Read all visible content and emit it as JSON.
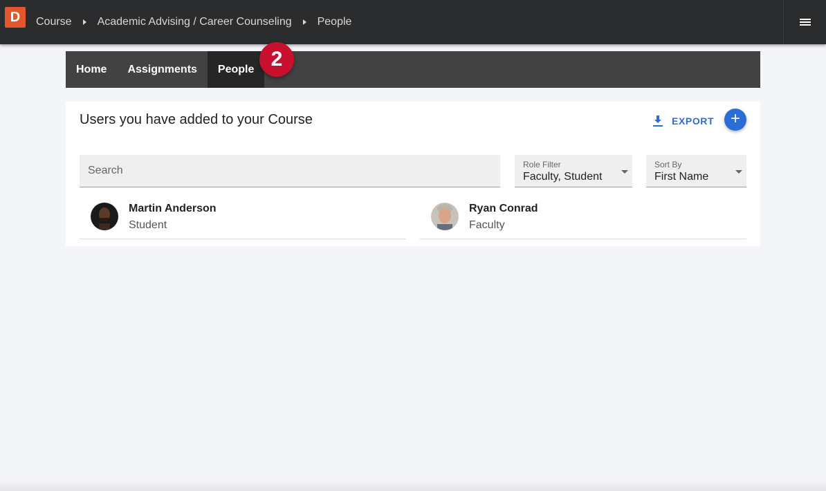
{
  "app": {
    "logo_letter": "D",
    "breadcrumbs": [
      "Course",
      "Academic Advising / Career Counseling",
      "People"
    ]
  },
  "tabs": [
    {
      "label": "Home",
      "active": false
    },
    {
      "label": "Assignments",
      "active": false
    },
    {
      "label": "People",
      "active": true
    }
  ],
  "step_badge": "2",
  "card": {
    "title": "Users you have added to your Course",
    "export_label": "EXPORT",
    "add_label": "+",
    "search": {
      "placeholder": "Search",
      "value": ""
    },
    "role_filter": {
      "label": "Role Filter",
      "value": "Faculty, Student"
    },
    "sort_by": {
      "label": "Sort By",
      "value": "First Name"
    },
    "people": [
      {
        "name": "Martin Anderson",
        "role": "Student"
      },
      {
        "name": "Ryan Conrad",
        "role": "Faculty"
      }
    ]
  },
  "colors": {
    "topbar": "#2b2c2e",
    "logo": "#e4572e",
    "tabbar": "#424242",
    "tab_active": "#262626",
    "badge": "#c8102e",
    "accent": "#2a6dd6",
    "background": "#f4f5f9"
  }
}
